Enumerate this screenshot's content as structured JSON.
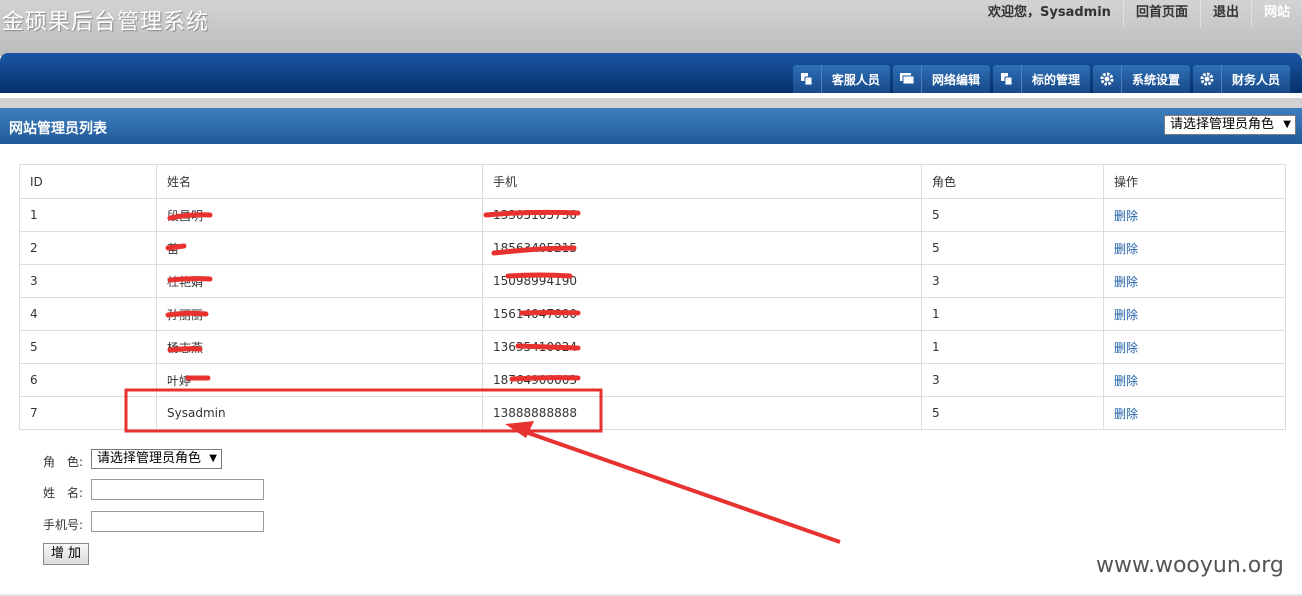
{
  "header": {
    "title": "金硕果后台管理系统",
    "welcome": "欢迎您，Sysadmin",
    "links": [
      "回首页面",
      "退出",
      "网站"
    ]
  },
  "nav": {
    "tabs": [
      {
        "label": "客服人员",
        "icon": "copy-icon"
      },
      {
        "label": "网络编辑",
        "icon": "windows-icon"
      },
      {
        "label": "标的管理",
        "icon": "copy-icon"
      },
      {
        "label": "系统设置",
        "icon": "gear-icon"
      },
      {
        "label": "财务人员",
        "icon": "gear-icon"
      }
    ]
  },
  "list": {
    "title": "网站管理员列表",
    "role_filter": "请选择管理员角色"
  },
  "table": {
    "headers": [
      "ID",
      "姓名",
      "手机",
      "角色",
      "操作"
    ],
    "rows": [
      {
        "id": "1",
        "name": "段昌明",
        "phone": "13305105730",
        "role": "5",
        "action": "删除"
      },
      {
        "id": "2",
        "name": "苗",
        "phone": "18563405215",
        "role": "5",
        "action": "删除"
      },
      {
        "id": "3",
        "name": "杜艳娟",
        "phone": "15098994190",
        "role": "3",
        "action": "删除"
      },
      {
        "id": "4",
        "name": "孙丽丽",
        "phone": "15614047000",
        "role": "1",
        "action": "删除"
      },
      {
        "id": "5",
        "name": "杨志燕",
        "phone": "13635410024",
        "role": "1",
        "action": "删除"
      },
      {
        "id": "6",
        "name": "叶婷",
        "phone": "18764900003",
        "role": "3",
        "action": "删除"
      },
      {
        "id": "7",
        "name": "Sysadmin",
        "phone": "13888888888",
        "role": "5",
        "action": "删除"
      }
    ]
  },
  "form": {
    "role_label": "角　色:",
    "role_value": "请选择管理员角色",
    "name_label": "姓　名:",
    "name_value": "",
    "phone_label": "手机号:",
    "phone_value": "",
    "add_button": "增 加"
  },
  "watermark": "www.wooyun.org",
  "colors": {
    "nav_blue": "#0c3b7a",
    "list_bar": "#2e6aa9",
    "annotation_red": "#e8322f",
    "link_blue": "#1f5fa8"
  }
}
